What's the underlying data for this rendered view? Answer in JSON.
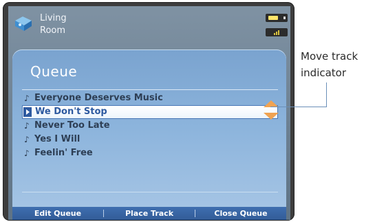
{
  "topbar": {
    "room_line1": "Living",
    "room_line2": "Room",
    "room_icon": "speaker-zone-icon",
    "battery_icon": "battery-icon",
    "signal_icon": "signal-icon"
  },
  "queue": {
    "title": "Queue",
    "tracks": [
      {
        "label": "Everyone Deserves Music",
        "icon": "music-note-icon"
      },
      {
        "label": "We Don't Stop",
        "icon": "play-indicator-icon",
        "selected": true
      },
      {
        "label": "Never Too Late",
        "icon": "music-note-icon"
      },
      {
        "label": "Yes I Will",
        "icon": "music-note-icon"
      },
      {
        "label": "Feelin' Free",
        "icon": "music-note-icon"
      }
    ]
  },
  "buttons": {
    "edit_queue": "Edit Queue",
    "place_track": "Place Track",
    "close_queue": "Close Queue"
  },
  "callout": {
    "line1": "Move track",
    "line2": "indicator"
  },
  "colors": {
    "accent": "#f0a352",
    "selected_text": "#2e5aa0",
    "button_bar": "#3f6fb0"
  }
}
